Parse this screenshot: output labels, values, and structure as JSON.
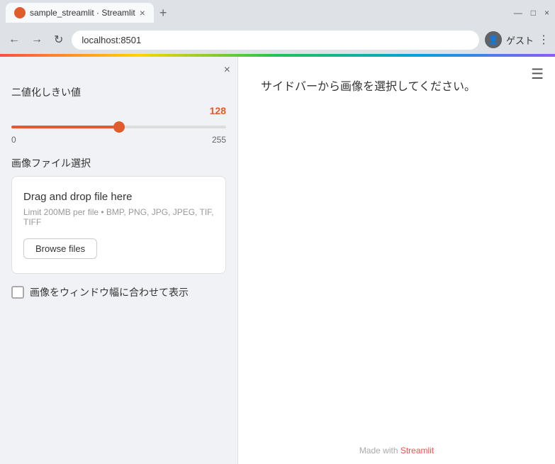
{
  "browser": {
    "tab_title": "sample_streamlit · Streamlit",
    "address": "localhost:8501",
    "user_label": "ゲスト",
    "new_tab_icon": "+",
    "back_icon": "←",
    "forward_icon": "→",
    "refresh_icon": "↻",
    "menu_icon": "⋮",
    "minimize_icon": "—",
    "maximize_icon": "□",
    "close_icon": "×"
  },
  "sidebar": {
    "close_icon": "×",
    "slider": {
      "label": "二値化しきい値",
      "value": 128,
      "min": 0,
      "max": 255,
      "min_label": "0",
      "max_label": "255"
    },
    "file_upload": {
      "label": "画像ファイル選択",
      "drag_drop_text": "Drag and drop file here",
      "limit_text": "Limit 200MB per file • BMP, PNG, JPG, JPEG, TIF, TIFF",
      "browse_label": "Browse files"
    },
    "checkbox": {
      "label": "画像をウィンドウ幅に合わせて表示"
    }
  },
  "main": {
    "instruction": "サイドバーから画像を選択してください。",
    "footer_text": "Made with ",
    "footer_link_text": "Streamlit"
  }
}
